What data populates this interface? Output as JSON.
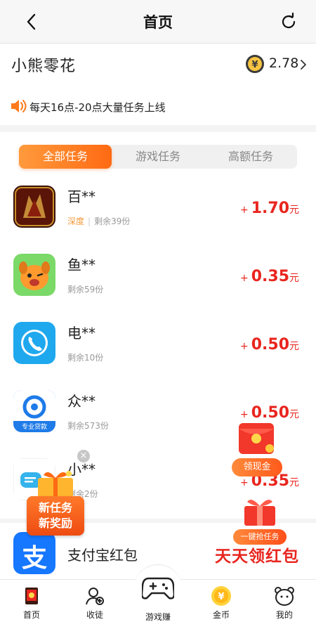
{
  "nav": {
    "title": "首页"
  },
  "user": {
    "name": "小熊零花",
    "balance": "2.78"
  },
  "notice": {
    "text": "每天16点-20点大量任务上线"
  },
  "tabs": [
    {
      "label": "全部任务",
      "active": true
    },
    {
      "label": "游戏任务",
      "active": false
    },
    {
      "label": "高额任务",
      "active": false
    }
  ],
  "tasks": [
    {
      "name": "百**",
      "tag": "深度",
      "remaining": "剩余39份",
      "plus": "+",
      "amount": "1.70",
      "unit": "元",
      "icon": "dragon-game-icon"
    },
    {
      "name": "鱼**",
      "tag": "",
      "remaining": "剩余59份",
      "plus": "+",
      "amount": "0.35",
      "unit": "元",
      "icon": "dog-mascot-icon"
    },
    {
      "name": "电**",
      "tag": "",
      "remaining": "剩余10份",
      "plus": "+",
      "amount": "0.50",
      "unit": "元",
      "icon": "phone-icon"
    },
    {
      "name": "众**",
      "tag": "",
      "remaining": "剩余573份",
      "plus": "+",
      "amount": "0.50",
      "unit": "元",
      "icon": "loan-app-icon",
      "icon_caption": "专业贷款"
    },
    {
      "name": "小**",
      "tag": "",
      "remaining": "剩余2份",
      "plus": "+",
      "amount": "0.35",
      "unit": "元",
      "icon": "chat-app-icon"
    }
  ],
  "floats": {
    "new_task_line1": "新任务",
    "new_task_line2": "新奖励",
    "get_cash": "领现金",
    "grab_task": "一键抢任务",
    "close": "×"
  },
  "alipay": {
    "label": "支付宝红包",
    "promo": "天天领红包",
    "icon_char": "支"
  },
  "tabbar": [
    {
      "label": "首页",
      "icon": "home-icon"
    },
    {
      "label": "收徒",
      "icon": "apprentice-icon"
    },
    {
      "label": "游戏赚",
      "icon": "gamepad-icon"
    },
    {
      "label": "金币",
      "icon": "coin-icon"
    },
    {
      "label": "我的",
      "icon": "bear-profile-icon"
    }
  ],
  "coin_symbol": "¥",
  "colors": {
    "accent": "#ff6a13",
    "price": "#e8261f",
    "tag": "#f59a3b"
  }
}
